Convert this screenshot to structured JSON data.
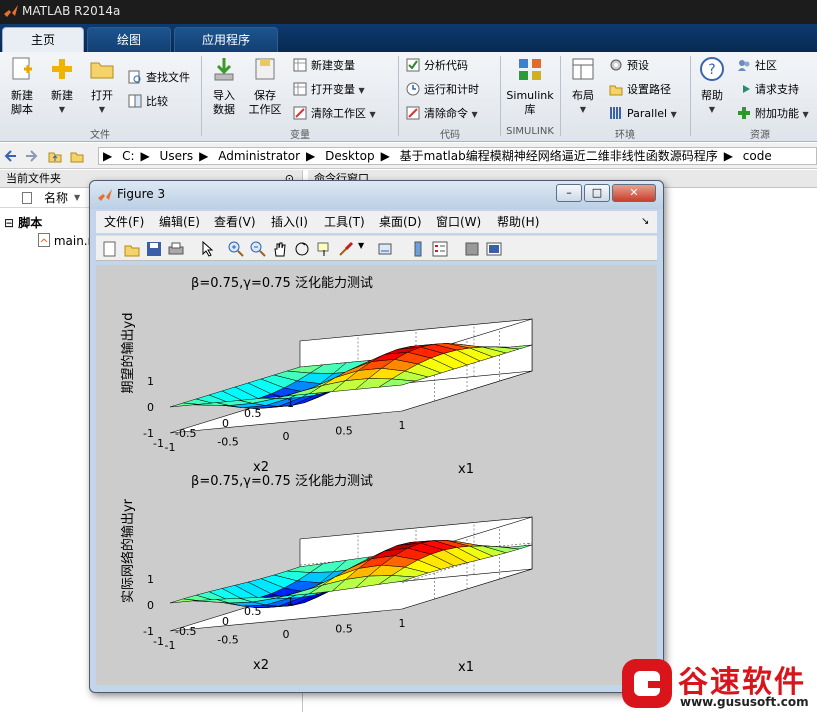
{
  "app": {
    "title": "MATLAB R2014a"
  },
  "tabs": [
    {
      "label": "主页",
      "active": true
    },
    {
      "label": "绘图",
      "active": false
    },
    {
      "label": "应用程序",
      "active": false
    }
  ],
  "ribbon": {
    "file": {
      "new_script": "新建\n脚本",
      "new": "新建",
      "open": "打开",
      "find_files": "查找文件",
      "compare": "比较",
      "section": "文件"
    },
    "variable": {
      "import": "导入\n数据",
      "save_workspace": "保存\n工作区",
      "new_variable": "新建变量",
      "open_variable": "打开变量",
      "clear_workspace": "清除工作区",
      "section": "变量"
    },
    "code": {
      "analyze": "分析代码",
      "run_time": "运行和计时",
      "clear_commands": "清除命令",
      "section": "代码"
    },
    "simulink": {
      "label": "Simulink\n库",
      "section": "SIMULINK"
    },
    "env": {
      "layout": "布局",
      "preferences": "预设",
      "set_path": "设置路径",
      "parallel": "Parallel",
      "section": "环境"
    },
    "resources": {
      "help": "帮助",
      "community": "社区",
      "request_support": "请求支持",
      "addons": "附加功能",
      "section": "资源"
    }
  },
  "address": {
    "crumbs": [
      "C:",
      "Users",
      "Administrator",
      "Desktop",
      "基于matlab编程模糊神经网络逼近二维非线性函数源码程序",
      "code"
    ]
  },
  "current_folder": {
    "header": "当前文件夹",
    "col_name": "名称",
    "group": "脚本",
    "file": "main.m"
  },
  "command_window": {
    "header": "命令行窗口"
  },
  "figure": {
    "title": "Figure 3",
    "menu": [
      "文件(F)",
      "编辑(E)",
      "查看(V)",
      "插入(I)",
      "工具(T)",
      "桌面(D)",
      "窗口(W)",
      "帮助(H)"
    ],
    "plots": [
      {
        "title": "β=0.75,γ=0.75 泛化能力测试",
        "zlabel": "期望的输出yd",
        "xlabel": "x1",
        "ylabel": "x2"
      },
      {
        "title": "β=0.75,γ=0.75 泛化能力测试",
        "zlabel": "实际网络的输出yr",
        "xlabel": "x1",
        "ylabel": "x2"
      }
    ],
    "z_ticks": [
      "1",
      "0",
      "-1"
    ],
    "x1_ticks": [
      "-1",
      "-0.5",
      "0",
      "0.5",
      "1"
    ],
    "x2_ticks": [
      "1",
      "0.5",
      "0",
      "-0.5",
      "-1"
    ]
  },
  "watermark": {
    "brand": "谷速软件",
    "url": "www.gususoft.com",
    "color": "#d9141b"
  },
  "colors": {
    "tab_bar": "#0d3a70",
    "ribbon": "#e6ebf0",
    "figure_frame": "#c2d5ea"
  }
}
